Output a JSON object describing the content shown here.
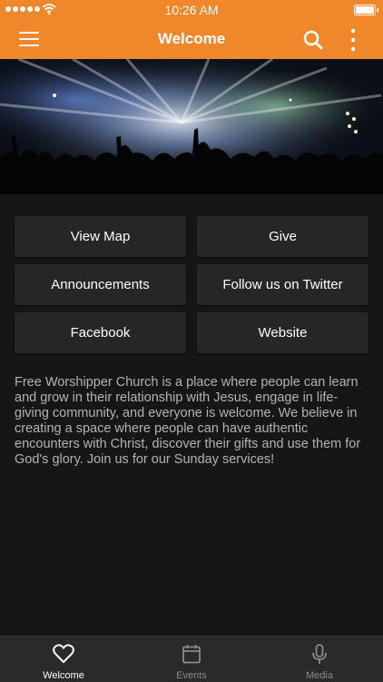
{
  "status_bar": {
    "time": "10:26 AM"
  },
  "navbar": {
    "title": "Welcome"
  },
  "buttons": {
    "view_map": "View Map",
    "give": "Give",
    "announcements": "Announcements",
    "twitter": "Follow us on Twitter",
    "facebook": "Facebook",
    "website": "Website"
  },
  "description": "Free Worshipper Church is a place where people can learn and grow in their relationship with Jesus,  engage in life-giving community, and everyone is welcome. We believe in creating a space where people can have authentic encounters with Christ, discover their gifts and use them for God's glory. Join us for our Sunday services!",
  "tabs": [
    {
      "label": "Welcome",
      "icon": "heart-icon",
      "active": true
    },
    {
      "label": "Events",
      "icon": "calendar-icon",
      "active": false
    },
    {
      "label": "Media",
      "icon": "microphone-icon",
      "active": false
    }
  ],
  "colors": {
    "accent": "#f0872a",
    "background": "#161616",
    "button": "#262626",
    "tabbar": "#2a2a2a"
  }
}
